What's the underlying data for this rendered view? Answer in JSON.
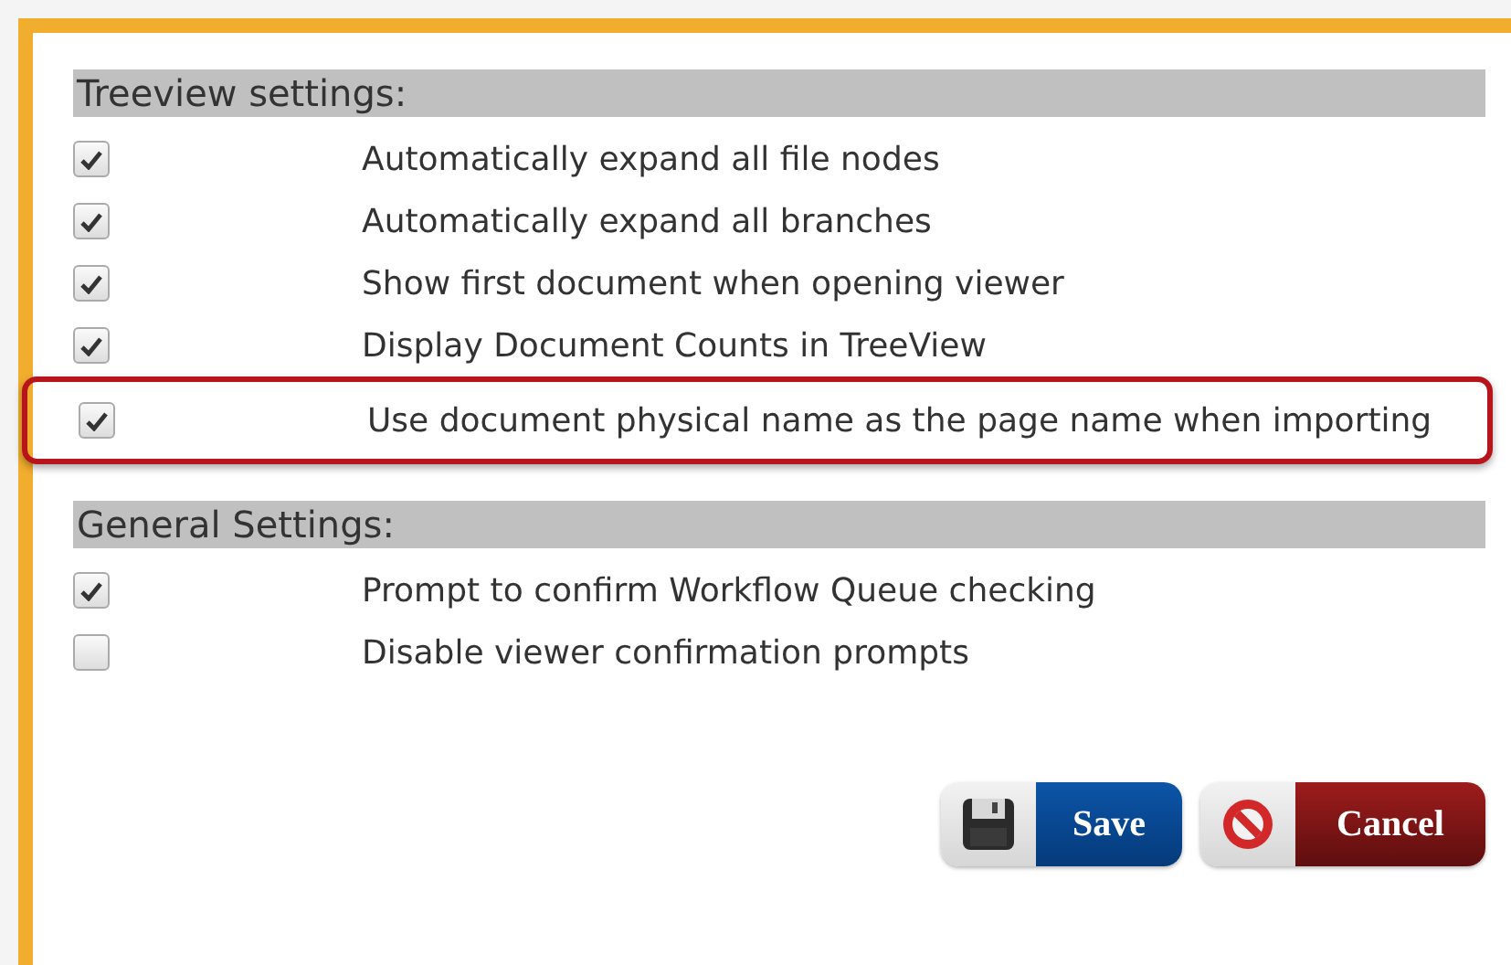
{
  "sections": [
    {
      "title": "Treeview settings:",
      "options": [
        {
          "label": "Automatically expand all file nodes",
          "checked": true,
          "highlighted": false
        },
        {
          "label": "Automatically expand all branches",
          "checked": true,
          "highlighted": false
        },
        {
          "label": "Show first document when opening viewer",
          "checked": true,
          "highlighted": false
        },
        {
          "label": "Display Document Counts in TreeView",
          "checked": true,
          "highlighted": false
        },
        {
          "label": "Use document physical name as the page name when importing",
          "checked": true,
          "highlighted": true
        }
      ]
    },
    {
      "title": "General Settings:",
      "options": [
        {
          "label": "Prompt to confirm Workflow Queue checking",
          "checked": true,
          "highlighted": false
        },
        {
          "label": "Disable viewer confirmation prompts",
          "checked": false,
          "highlighted": false
        }
      ]
    }
  ],
  "buttons": [
    {
      "label": "Save",
      "kind": "save"
    },
    {
      "label": "Cancel",
      "kind": "cancel"
    }
  ]
}
